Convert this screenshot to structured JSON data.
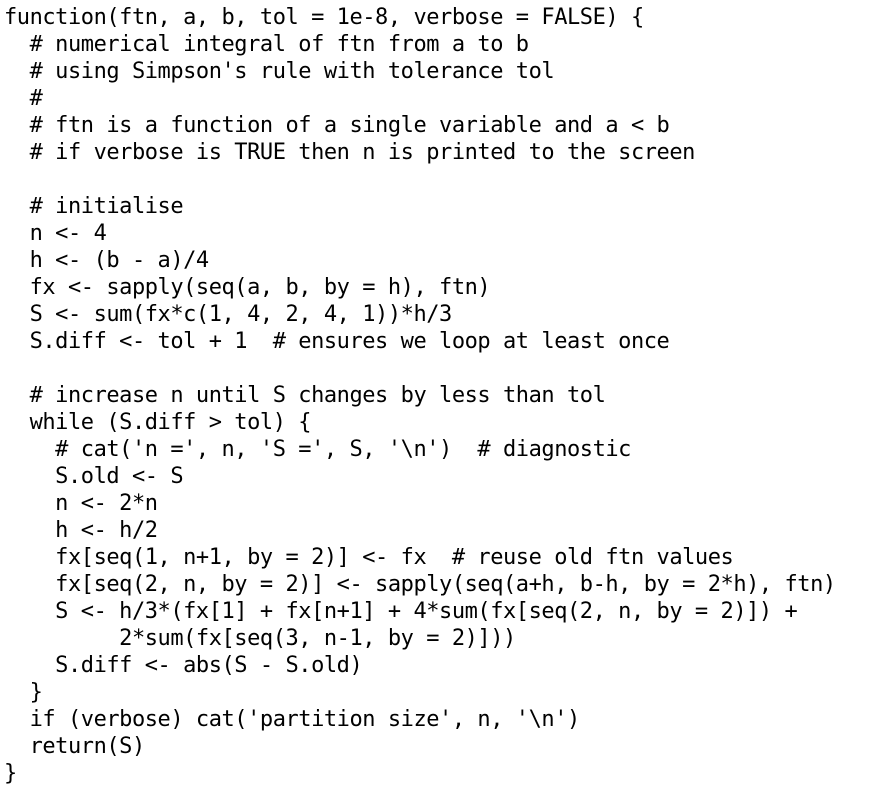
{
  "code": {
    "lines": [
      "function(ftn, a, b, tol = 1e-8, verbose = FALSE) {",
      "  # numerical integral of ftn from a to b",
      "  # using Simpson's rule with tolerance tol",
      "  #",
      "  # ftn is a function of a single variable and a < b",
      "  # if verbose is TRUE then n is printed to the screen",
      "",
      "  # initialise",
      "  n <- 4",
      "  h <- (b - a)/4",
      "  fx <- sapply(seq(a, b, by = h), ftn)",
      "  S <- sum(fx*c(1, 4, 2, 4, 1))*h/3",
      "  S.diff <- tol + 1  # ensures we loop at least once",
      "",
      "  # increase n until S changes by less than tol",
      "  while (S.diff > tol) {",
      "    # cat('n =', n, 'S =', S, '\\n')  # diagnostic",
      "    S.old <- S",
      "    n <- 2*n",
      "    h <- h/2",
      "    fx[seq(1, n+1, by = 2)] <- fx  # reuse old ftn values",
      "    fx[seq(2, n, by = 2)] <- sapply(seq(a+h, b-h, by = 2*h), ftn)",
      "    S <- h/3*(fx[1] + fx[n+1] + 4*sum(fx[seq(2, n, by = 2)]) +",
      "         2*sum(fx[seq(3, n-1, by = 2)]))",
      "    S.diff <- abs(S - S.old)",
      "  }",
      "  if (verbose) cat('partition size', n, '\\n')",
      "  return(S)",
      "}"
    ]
  }
}
